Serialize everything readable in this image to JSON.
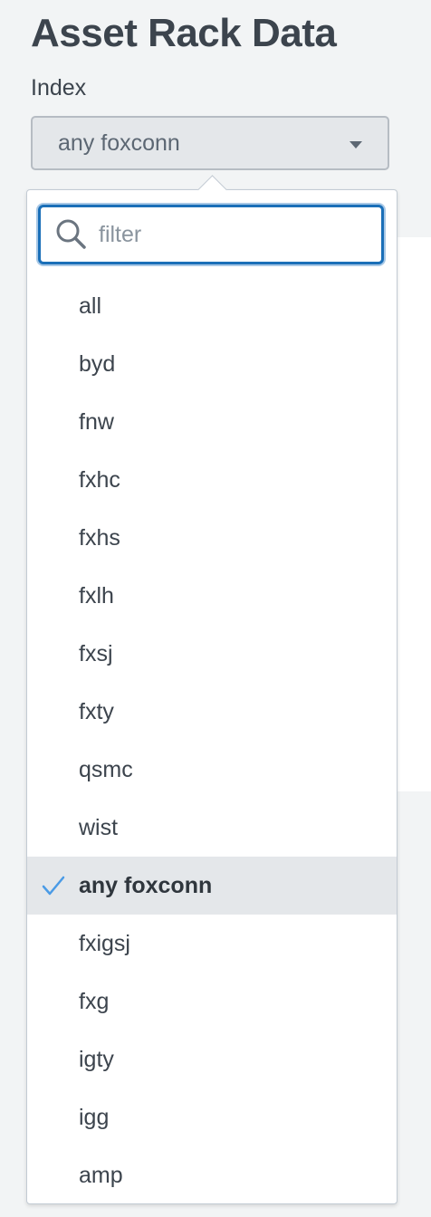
{
  "page": {
    "title": "Asset Rack Data"
  },
  "index_field": {
    "label": "Index",
    "selected_value": "any foxconn"
  },
  "dropdown": {
    "filter_placeholder": "filter",
    "filter_value": "",
    "options": [
      {
        "label": "all",
        "selected": false
      },
      {
        "label": "byd",
        "selected": false
      },
      {
        "label": "fnw",
        "selected": false
      },
      {
        "label": "fxhc",
        "selected": false
      },
      {
        "label": "fxhs",
        "selected": false
      },
      {
        "label": "fxlh",
        "selected": false
      },
      {
        "label": "fxsj",
        "selected": false
      },
      {
        "label": "fxty",
        "selected": false
      },
      {
        "label": "qsmc",
        "selected": false
      },
      {
        "label": "wist",
        "selected": false
      },
      {
        "label": "any foxconn",
        "selected": true
      },
      {
        "label": "fxigsj",
        "selected": false
      },
      {
        "label": "fxg",
        "selected": false
      },
      {
        "label": "igty",
        "selected": false
      },
      {
        "label": "igg",
        "selected": false
      },
      {
        "label": "amp",
        "selected": false
      }
    ]
  },
  "icons": {
    "search": "search-icon",
    "caret": "caret-down-icon",
    "check": "check-icon"
  },
  "colors": {
    "accent": "#1a6fb8",
    "check": "#4a9be6",
    "selected_row": "#e4e7ea"
  }
}
